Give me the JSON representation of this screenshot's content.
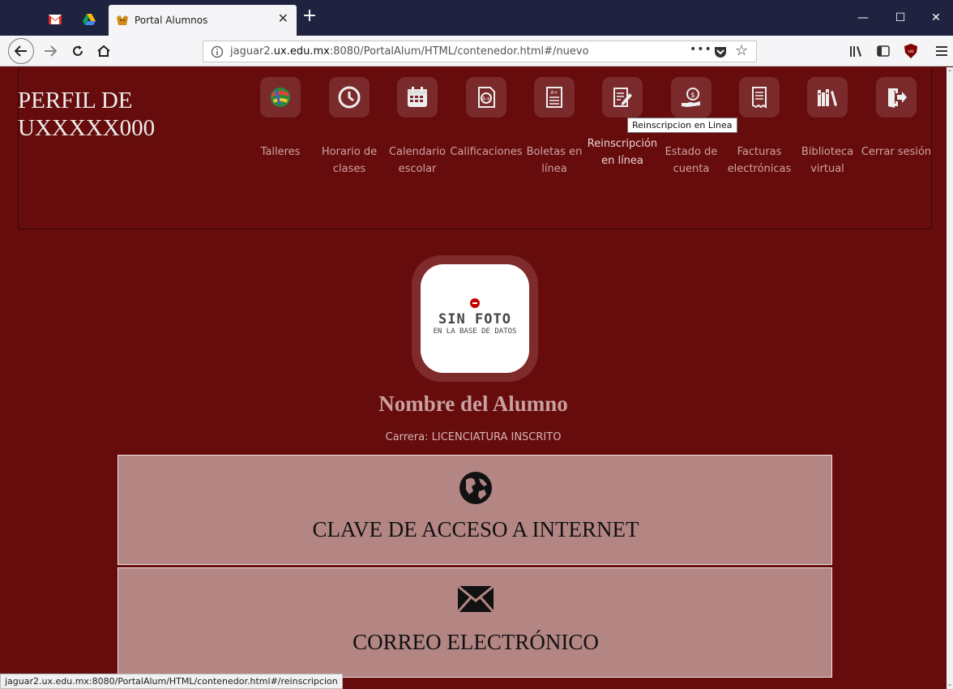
{
  "browser": {
    "tab_title": "Portal Alumnos",
    "url_prefix": "jaguar2.",
    "url_domain": "ux.edu.mx",
    "url_suffix": ":8080/PortalAlum/HTML/contenedor.html#/nuevo",
    "status_url": "jaguar2.ux.edu.mx:8080/PortalAlum/HTML/contenedor.html#/reinscripcion"
  },
  "header": {
    "perfil_line1": "PERFIL DE",
    "perfil_line2": "UXXXXX000"
  },
  "menu": [
    {
      "label_1": "Talleres",
      "label_2": "",
      "icon": "globe-books-icon"
    },
    {
      "label_1": "Horario de",
      "label_2": "clases",
      "icon": "clock-icon"
    },
    {
      "label_1": "Calendario",
      "label_2": "escolar",
      "icon": "calendar-icon"
    },
    {
      "label_1": "Calificaciones",
      "label_2": "",
      "icon": "grade-document-icon"
    },
    {
      "label_1": "Boletas en",
      "label_2": "línea",
      "icon": "report-card-icon"
    },
    {
      "label_1": "Reinscripción",
      "label_2": "en línea",
      "icon": "edit-document-icon"
    },
    {
      "label_1": "Estado de",
      "label_2": "cuenta",
      "icon": "money-hand-icon"
    },
    {
      "label_1": "Facturas",
      "label_2": "electrónicas",
      "icon": "invoice-icon"
    },
    {
      "label_1": "Biblioteca",
      "label_2": "virtual",
      "icon": "library-icon"
    },
    {
      "label_1": "Cerrar sesión",
      "label_2": "",
      "icon": "logout-icon"
    }
  ],
  "tooltip": "Reinscripcion en Linea",
  "photo": {
    "title": "SIN FOTO",
    "subtitle": "EN LA BASE DE DATOS"
  },
  "student": {
    "name": "Nombre del Alumno",
    "carrera": "Carrera: LICENCIATURA INSCRITO"
  },
  "cards": [
    {
      "title": "CLAVE DE ACCESO A INTERNET",
      "icon": "globe-icon"
    },
    {
      "title": "CORREO ELECTRÓNICO",
      "icon": "envelope-icon"
    }
  ]
}
